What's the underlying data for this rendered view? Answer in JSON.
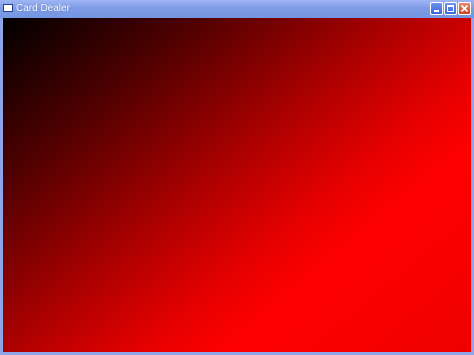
{
  "window": {
    "title": "Card Dealer",
    "icons": {
      "app": "window-app-icon",
      "minimize": "minimize-icon",
      "maximize": "maximize-icon",
      "close": "close-icon"
    },
    "colors": {
      "titlebar": "#7f9ce6",
      "frame": "#8fa4e8",
      "close_button": "#c84420"
    }
  },
  "canvas": {
    "gradient_colors": [
      "#000000",
      "#4d0000",
      "#a80000",
      "#ff0000"
    ]
  }
}
